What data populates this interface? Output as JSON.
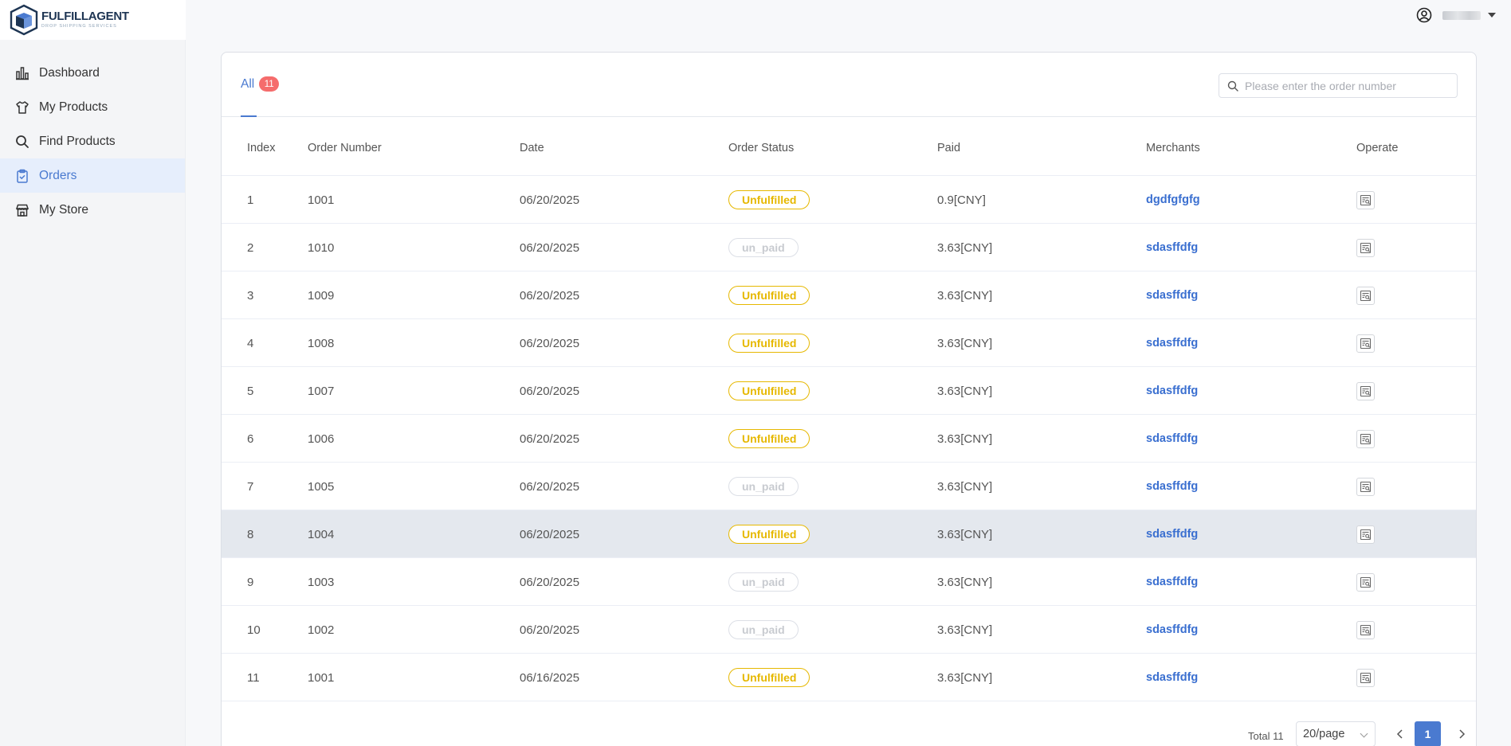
{
  "brand": {
    "name_part1": "FULFILL",
    "name_part2": "AGENT",
    "tagline": "DROP SHIPPING SERVICES"
  },
  "sidebar": {
    "items": [
      {
        "label": "Dashboard",
        "icon": "bar-chart-icon",
        "active": false
      },
      {
        "label": "My Products",
        "icon": "shirt-icon",
        "active": false
      },
      {
        "label": "Find Products",
        "icon": "search-icon",
        "active": false
      },
      {
        "label": "Orders",
        "icon": "clipboard-icon",
        "active": true
      },
      {
        "label": "My Store",
        "icon": "store-icon",
        "active": false
      }
    ]
  },
  "header": {
    "user_icon": "user-circle-icon"
  },
  "tabs": {
    "all_label": "All",
    "all_count": "11"
  },
  "search": {
    "placeholder": "Please enter the order number",
    "value": ""
  },
  "table": {
    "columns": [
      "Index",
      "Order Number",
      "Date",
      "Order Status",
      "Paid",
      "Merchants",
      "Operate"
    ],
    "rows": [
      {
        "index": "1",
        "order": "1001",
        "date": "06/20/2025",
        "status": "Unfulfilled",
        "paid": "0.9[CNY]",
        "merchant": "dgdfgfgfg"
      },
      {
        "index": "2",
        "order": "1010",
        "date": "06/20/2025",
        "status": "un_paid",
        "paid": "3.63[CNY]",
        "merchant": "sdasffdfg"
      },
      {
        "index": "3",
        "order": "1009",
        "date": "06/20/2025",
        "status": "Unfulfilled",
        "paid": "3.63[CNY]",
        "merchant": "sdasffdfg"
      },
      {
        "index": "4",
        "order": "1008",
        "date": "06/20/2025",
        "status": "Unfulfilled",
        "paid": "3.63[CNY]",
        "merchant": "sdasffdfg"
      },
      {
        "index": "5",
        "order": "1007",
        "date": "06/20/2025",
        "status": "Unfulfilled",
        "paid": "3.63[CNY]",
        "merchant": "sdasffdfg"
      },
      {
        "index": "6",
        "order": "1006",
        "date": "06/20/2025",
        "status": "Unfulfilled",
        "paid": "3.63[CNY]",
        "merchant": "sdasffdfg"
      },
      {
        "index": "7",
        "order": "1005",
        "date": "06/20/2025",
        "status": "un_paid",
        "paid": "3.63[CNY]",
        "merchant": "sdasffdfg"
      },
      {
        "index": "8",
        "order": "1004",
        "date": "06/20/2025",
        "status": "Unfulfilled",
        "paid": "3.63[CNY]",
        "merchant": "sdasffdfg"
      },
      {
        "index": "9",
        "order": "1003",
        "date": "06/20/2025",
        "status": "un_paid",
        "paid": "3.63[CNY]",
        "merchant": "sdasffdfg"
      },
      {
        "index": "10",
        "order": "1002",
        "date": "06/20/2025",
        "status": "un_paid",
        "paid": "3.63[CNY]",
        "merchant": "sdasffdfg"
      },
      {
        "index": "11",
        "order": "1001",
        "date": "06/16/2025",
        "status": "Unfulfilled",
        "paid": "3.63[CNY]",
        "merchant": "sdasffdfg"
      }
    ],
    "operate_icon": "order-detail-icon"
  },
  "pagination": {
    "total_label": "Total 11",
    "page_size": "20/page",
    "current_page": "1"
  },
  "colors": {
    "accent": "#4a7ad0",
    "badge": "#f56c6c",
    "unfulfilled": "#e6b800",
    "unpaid": "#c8cbd0",
    "merchant_link": "#3a6fd0"
  }
}
